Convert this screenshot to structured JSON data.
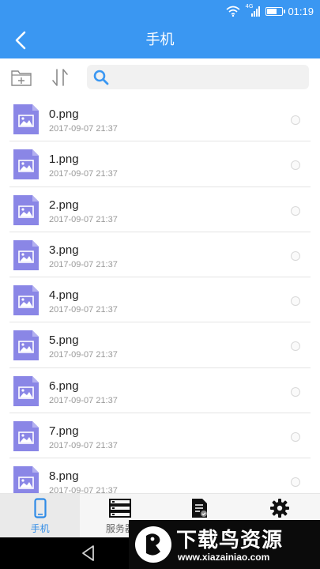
{
  "status_bar": {
    "network": "4G",
    "time": "01:19"
  },
  "app_bar": {
    "title": "手机",
    "back_icon": "chevron-left-icon"
  },
  "toolbar": {
    "new_folder_icon": "new-folder-icon",
    "sort_icon": "sort-icon",
    "search_placeholder": ""
  },
  "files": [
    {
      "name": "0.png",
      "date": "2017-09-07 21:37"
    },
    {
      "name": "1.png",
      "date": "2017-09-07 21:37"
    },
    {
      "name": "2.png",
      "date": "2017-09-07 21:37"
    },
    {
      "name": "3.png",
      "date": "2017-09-07 21:37"
    },
    {
      "name": "4.png",
      "date": "2017-09-07 21:37"
    },
    {
      "name": "5.png",
      "date": "2017-09-07 21:37"
    },
    {
      "name": "6.png",
      "date": "2017-09-07 21:37"
    },
    {
      "name": "7.png",
      "date": "2017-09-07 21:37"
    },
    {
      "name": "8.png",
      "date": "2017-09-07 21:37"
    }
  ],
  "tabs": [
    {
      "label": "手机",
      "icon": "phone-icon",
      "active": true
    },
    {
      "label": "服务器",
      "icon": "server-icon",
      "active": false
    },
    {
      "label": "",
      "icon": "document-icon",
      "active": false
    },
    {
      "label": "",
      "icon": "gear-icon",
      "active": false
    }
  ],
  "watermark": {
    "title": "下载鸟资源",
    "url": "www.xiazainiao.com"
  },
  "colors": {
    "accent": "#3a97f2",
    "file_icon": "#8a86e6",
    "active_tab_label": "#2f8be6"
  }
}
